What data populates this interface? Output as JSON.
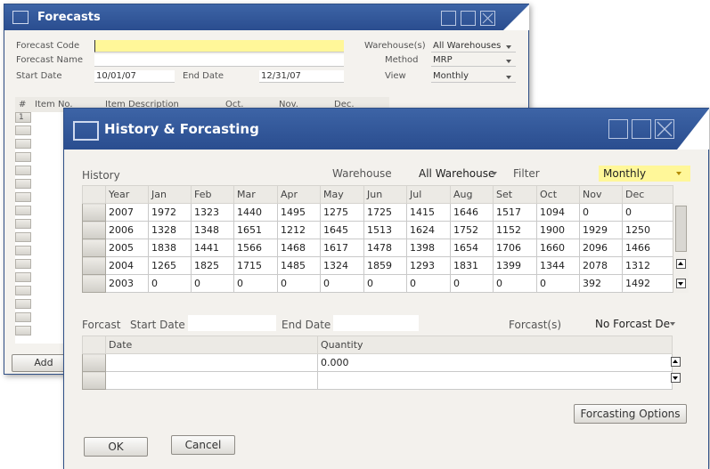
{
  "forecasts": {
    "title": "Forecasts",
    "fields": {
      "forecast_code_label": "Forecast Code",
      "forecast_code_value": "",
      "forecast_name_label": "Forecast Name",
      "forecast_name_value": "",
      "start_date_label": "Start Date",
      "start_date_value": "10/01/07",
      "end_date_label": "End Date",
      "end_date_value": "12/31/07",
      "warehouses_label": "Warehouse(s)",
      "warehouses_value": "All Warehouses",
      "method_label": "Method",
      "method_value": "MRP",
      "view_label": "View",
      "view_value": "Monthly"
    },
    "columns": [
      "#",
      "Item No.",
      "Item Description",
      "Oct.",
      "Nov.",
      "Dec."
    ],
    "first_row_number": "1",
    "add_button": "Add"
  },
  "history": {
    "title": "History & Forcasting",
    "history_label": "History",
    "warehouse_label": "Warehouse",
    "warehouse_value": "All Warehouse",
    "filter_label": "Filter",
    "filter_value": "Monthly",
    "columns": [
      "Year",
      "Jan",
      "Feb",
      "Mar",
      "Apr",
      "May",
      "Jun",
      "Jul",
      "Aug",
      "Set",
      "Oct",
      "Nov",
      "Dec"
    ],
    "rows": [
      [
        "2007",
        "1972",
        "1323",
        "1440",
        "1495",
        "1275",
        "1725",
        "1415",
        "1646",
        "1517",
        "1094",
        "0",
        "0"
      ],
      [
        "2006",
        "1328",
        "1348",
        "1651",
        "1212",
        "1645",
        "1513",
        "1624",
        "1752",
        "1152",
        "1900",
        "1929",
        "1250"
      ],
      [
        "2005",
        "1838",
        "1441",
        "1566",
        "1468",
        "1617",
        "1478",
        "1398",
        "1654",
        "1706",
        "1660",
        "2096",
        "1466"
      ],
      [
        "2004",
        "1265",
        "1825",
        "1715",
        "1485",
        "1324",
        "1859",
        "1293",
        "1831",
        "1399",
        "1344",
        "2078",
        "1312"
      ],
      [
        "2003",
        "0",
        "0",
        "0",
        "0",
        "0",
        "0",
        "0",
        "0",
        "0",
        "0",
        "392",
        "1492"
      ]
    ],
    "forcast_label": "Forcast",
    "start_date_label": "Start Date",
    "end_date_label": "End Date",
    "forcasts_label": "Forcast(s)",
    "forcasts_value": "No Forcast Del",
    "forecast_columns": [
      "Date",
      "Quantity"
    ],
    "forecast_rows": [
      [
        "",
        "0.000"
      ],
      [
        "",
        ""
      ]
    ],
    "options_button": "Forcasting Options",
    "ok_button": "OK",
    "cancel_button": "Cancel",
    "accent_color": "#fff799",
    "title_color": "#2a4d8f"
  }
}
